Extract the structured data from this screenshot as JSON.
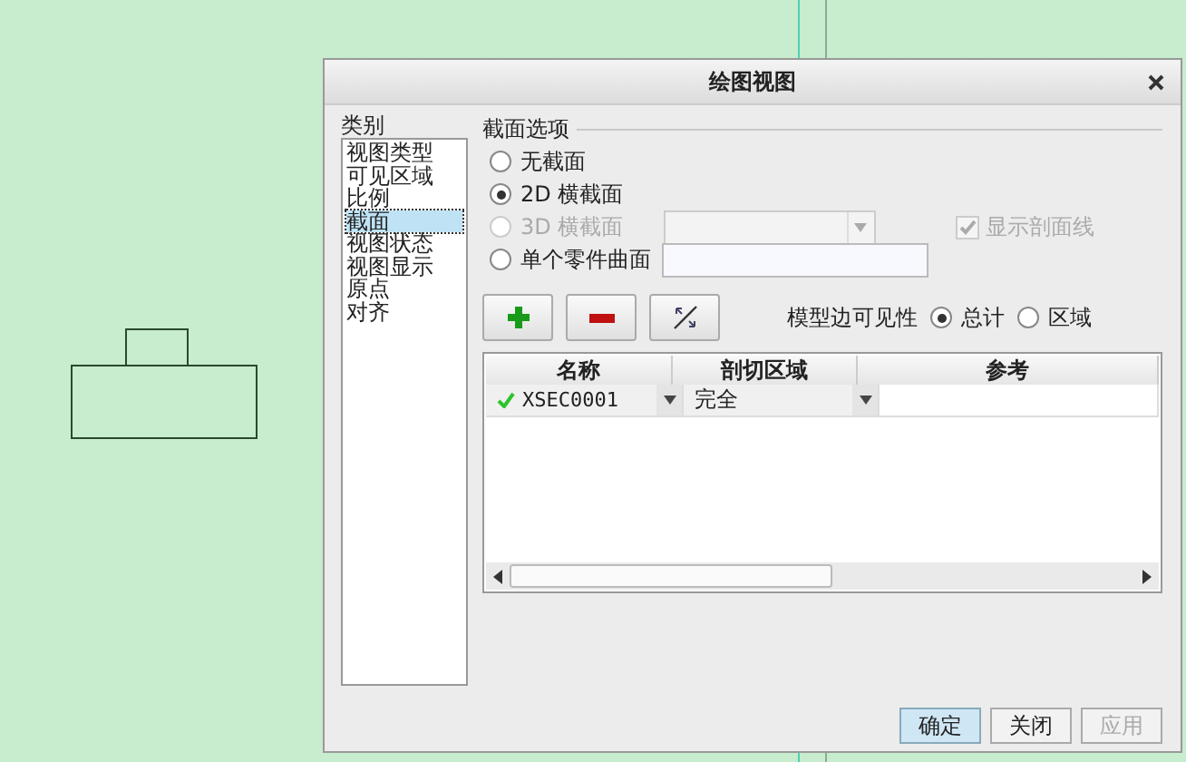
{
  "dialog": {
    "title": "绘图视图"
  },
  "categories": {
    "label": "类别",
    "items": [
      {
        "label": "视图类型",
        "selected": false
      },
      {
        "label": "可见区域",
        "selected": false
      },
      {
        "label": "比例",
        "selected": false
      },
      {
        "label": "截面",
        "selected": true
      },
      {
        "label": "视图状态",
        "selected": false
      },
      {
        "label": "视图显示",
        "selected": false
      },
      {
        "label": "原点",
        "selected": false
      },
      {
        "label": "对齐",
        "selected": false
      }
    ]
  },
  "section_options": {
    "label": "截面选项",
    "options": [
      {
        "kind": "plain",
        "label": "无截面",
        "selected": false,
        "disabled": false
      },
      {
        "kind": "plain",
        "label": "2D 横截面",
        "selected": true,
        "disabled": false
      },
      {
        "kind": "dropdown",
        "label": "3D 横截面",
        "selected": false,
        "disabled": true,
        "checkbox": {
          "label": "显示剖面线",
          "checked": true,
          "disabled": true
        }
      },
      {
        "kind": "field",
        "label": "单个零件曲面",
        "selected": false,
        "disabled": false
      }
    ]
  },
  "edge_visibility": {
    "label": "模型边可见性",
    "options": [
      {
        "label": "总计",
        "selected": true
      },
      {
        "label": "区域",
        "selected": false
      }
    ]
  },
  "table": {
    "columns": [
      "名称",
      "剖切区域",
      "参考"
    ],
    "rows": [
      {
        "name": "XSEC0001",
        "valid": true,
        "region": "完全"
      }
    ]
  },
  "buttons": [
    {
      "label": "确定",
      "default": true,
      "disabled": false
    },
    {
      "label": "关闭",
      "default": false,
      "disabled": false
    },
    {
      "label": "应用",
      "default": false,
      "disabled": true
    }
  ]
}
